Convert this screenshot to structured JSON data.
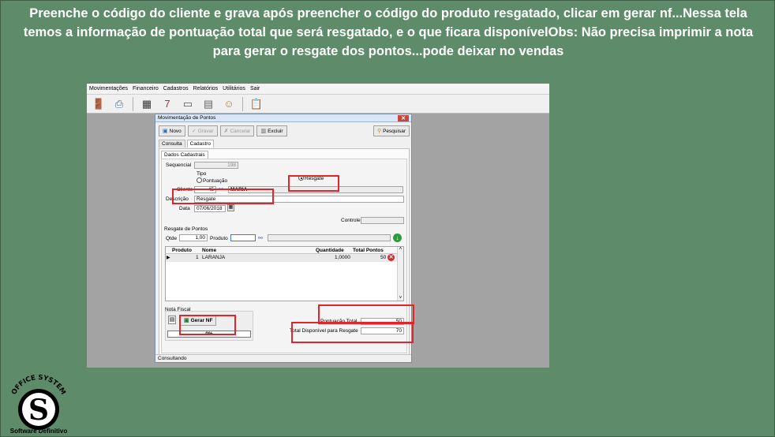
{
  "caption": "Preenche o código do cliente e grava após preencher o código do produto resgatado, clicar em gerar nf...Nessa tela temos a informação de pontuação total que será resgatado, e o que ficara disponívelObs: Não precisa imprimir a nota para gerar o resgate dos pontos...pode deixar no vendas",
  "menubar": [
    "Movimentações",
    "Financeiro",
    "Cadastros",
    "Relatórios",
    "Utilitários",
    "Sair"
  ],
  "toolbar_icons": [
    "exit-door-icon",
    "printer-icon",
    "calculator-icon",
    "calendar-icon",
    "window-icon",
    "database-icon",
    "users-icon",
    "clipboard-icon"
  ],
  "window": {
    "title": "Movimentação de Pontos",
    "buttons": {
      "novo": "Novo",
      "gravar": "Gravar",
      "cancelar": "Cancelar",
      "excluir": "Excluir",
      "pesquisar": "Pesquisar"
    },
    "tabs": [
      "Consulta",
      "Cadastro"
    ],
    "subtab": "Dados Cadastrais",
    "form": {
      "sequencial_label": "Sequencial",
      "sequencial_value": "198",
      "tipo_label": "Tipo",
      "pontuacao_option": "Pontuação",
      "resgate_option": "Resgate",
      "selected_tipo": "Resgate",
      "cliente_label": "Cliente",
      "cliente_code": "45",
      "cliente_name": "MARIA",
      "descricao_label": "Descrição",
      "descricao_value": "Resgate",
      "data_label": "Data",
      "data_value": "07/06/2018",
      "controle_label": "Controle",
      "resgate_section": "Resgate de Pontos",
      "qtde_label": "Qtde",
      "qtde_value": "1,00",
      "produto_label": "Produto",
      "produto_value": ""
    },
    "grid": {
      "columns": [
        "Produto",
        "Nome",
        "Quantidade",
        "Total Pontos"
      ],
      "rows": [
        {
          "produto": "1",
          "nome": "LARANJA",
          "quantidade": "1,0000",
          "total_pontos": "50"
        }
      ]
    },
    "totals": {
      "pontuacao_total_label": "Pontuação Total",
      "pontuacao_total_value": "50",
      "disponivel_label": "Total Disponível para Resgate",
      "disponivel_value": "70"
    },
    "nota_fiscal_label": "Nota Fiscal",
    "gerar_nf_label": "Gerar NF",
    "progress_text": "0%",
    "status_text": "Consultando"
  },
  "logo": {
    "arc_text": "OFFICE SYSTEM",
    "tagline": "Software Definitivo"
  },
  "colors": {
    "background": "#5e8b69",
    "highlight": "#e0262a"
  }
}
